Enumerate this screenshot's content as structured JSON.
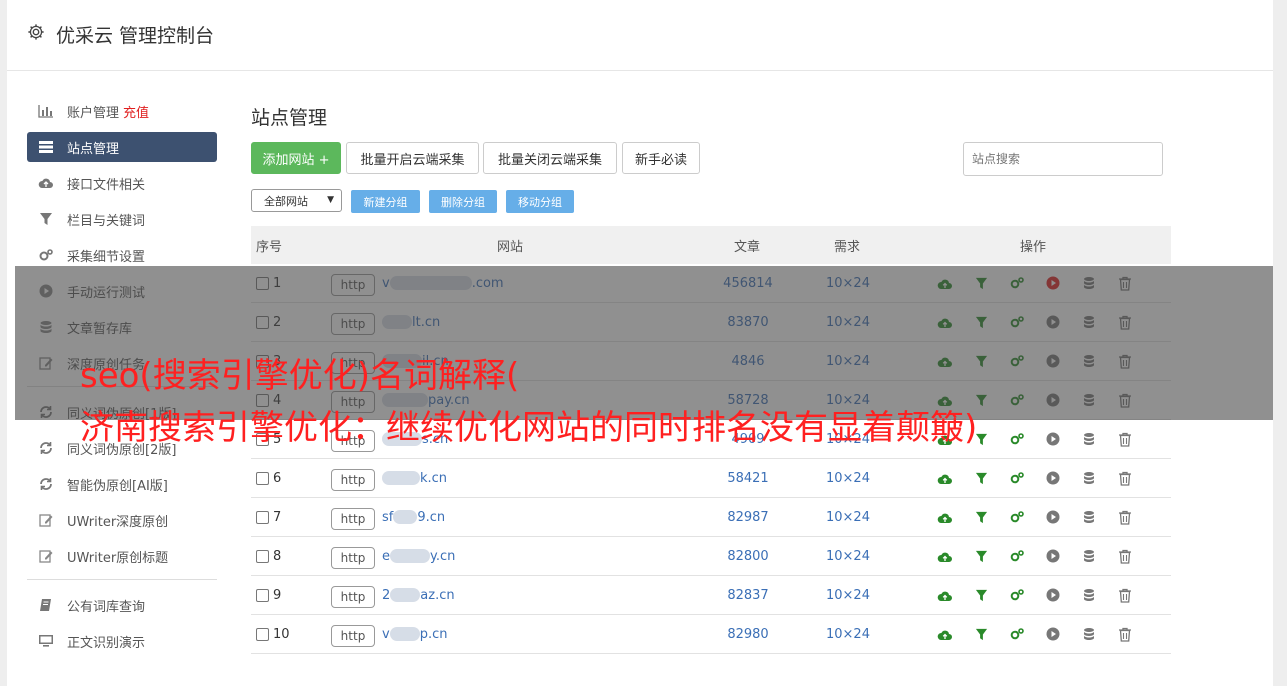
{
  "header": {
    "title": "优采云 管理控制台"
  },
  "sidebar": {
    "items": [
      {
        "label": "账户管理",
        "extra": "充值",
        "icon": "bar-chart-icon"
      },
      {
        "label": "站点管理",
        "icon": "server-icon",
        "active": true
      },
      {
        "label": "接口文件相关",
        "icon": "cloud-upload-icon"
      },
      {
        "label": "栏目与关键词",
        "icon": "filter-icon"
      },
      {
        "label": "采集细节设置",
        "icon": "gears-icon"
      },
      {
        "label": "手动运行测试",
        "icon": "play-icon"
      },
      {
        "label": "文章暂存库",
        "icon": "database-icon"
      },
      {
        "label": "深度原创任务",
        "icon": "edit-icon"
      }
    ],
    "items2": [
      {
        "label": "同义词伪原创[1版]",
        "icon": "refresh-icon"
      },
      {
        "label": "同义词伪原创[2版]",
        "icon": "refresh-icon"
      },
      {
        "label": "智能伪原创[AI版]",
        "icon": "refresh-icon"
      },
      {
        "label": "UWriter深度原创",
        "icon": "edit-icon"
      },
      {
        "label": "UWriter原创标题",
        "icon": "edit-icon"
      }
    ],
    "items3": [
      {
        "label": "公有词库查询",
        "icon": "book-icon"
      },
      {
        "label": "正文识别演示",
        "icon": "monitor-icon"
      }
    ]
  },
  "main": {
    "title": "站点管理",
    "buttons": {
      "add": "添加网站 +",
      "batch_on": "批量开启云端采集",
      "batch_off": "批量关闭云端采集",
      "guide": "新手必读"
    },
    "search_placeholder": "站点搜索",
    "group_select": "全部网站",
    "group_buttons": {
      "new": "新建分组",
      "delete": "删除分组",
      "move": "移动分组"
    },
    "table": {
      "headers": {
        "no": "序号",
        "site": "网站",
        "articles": "文章",
        "demand": "需求",
        "ops": "操作"
      },
      "http_label": "http",
      "rows": [
        {
          "no": "1",
          "site_prefix": "v",
          "site_suffix": ".com",
          "articles": "456814",
          "demand": "10×24",
          "running": true
        },
        {
          "no": "2",
          "site_prefix": "",
          "site_suffix": "lt.cn",
          "articles": "83870",
          "demand": "10×24"
        },
        {
          "no": "3",
          "site_prefix": "",
          "site_suffix": "il.cn",
          "articles": "4846",
          "demand": "10×24"
        },
        {
          "no": "4",
          "site_prefix": "",
          "site_suffix": "pay.cn",
          "articles": "58728",
          "demand": "10×24"
        },
        {
          "no": "5",
          "site_prefix": "",
          "site_suffix": "s.cn",
          "articles": "4909",
          "demand": "10×24"
        },
        {
          "no": "6",
          "site_prefix": "",
          "site_suffix": "k.cn",
          "articles": "58421",
          "demand": "10×24"
        },
        {
          "no": "7",
          "site_prefix": "sf",
          "site_suffix": "9.cn",
          "articles": "82987",
          "demand": "10×24"
        },
        {
          "no": "8",
          "site_prefix": "e",
          "site_suffix": "y.cn",
          "articles": "82800",
          "demand": "10×24"
        },
        {
          "no": "9",
          "site_prefix": "2",
          "site_suffix": "az.cn",
          "articles": "82837",
          "demand": "10×24"
        },
        {
          "no": "10",
          "site_prefix": "v",
          "site_suffix": "p.cn",
          "articles": "82980",
          "demand": "10×24"
        }
      ]
    }
  },
  "overlay": {
    "line1": "seo(搜索引擎优化)名词解释(",
    "line2": "济南搜索引擎优化：继续优化网站的同时排名没有显着颠簸)"
  },
  "colors": {
    "green": "#5cb85c",
    "navy": "#3d5170",
    "link": "#3b6fb6",
    "red": "#e02020",
    "light_blue": "#66aee8"
  }
}
